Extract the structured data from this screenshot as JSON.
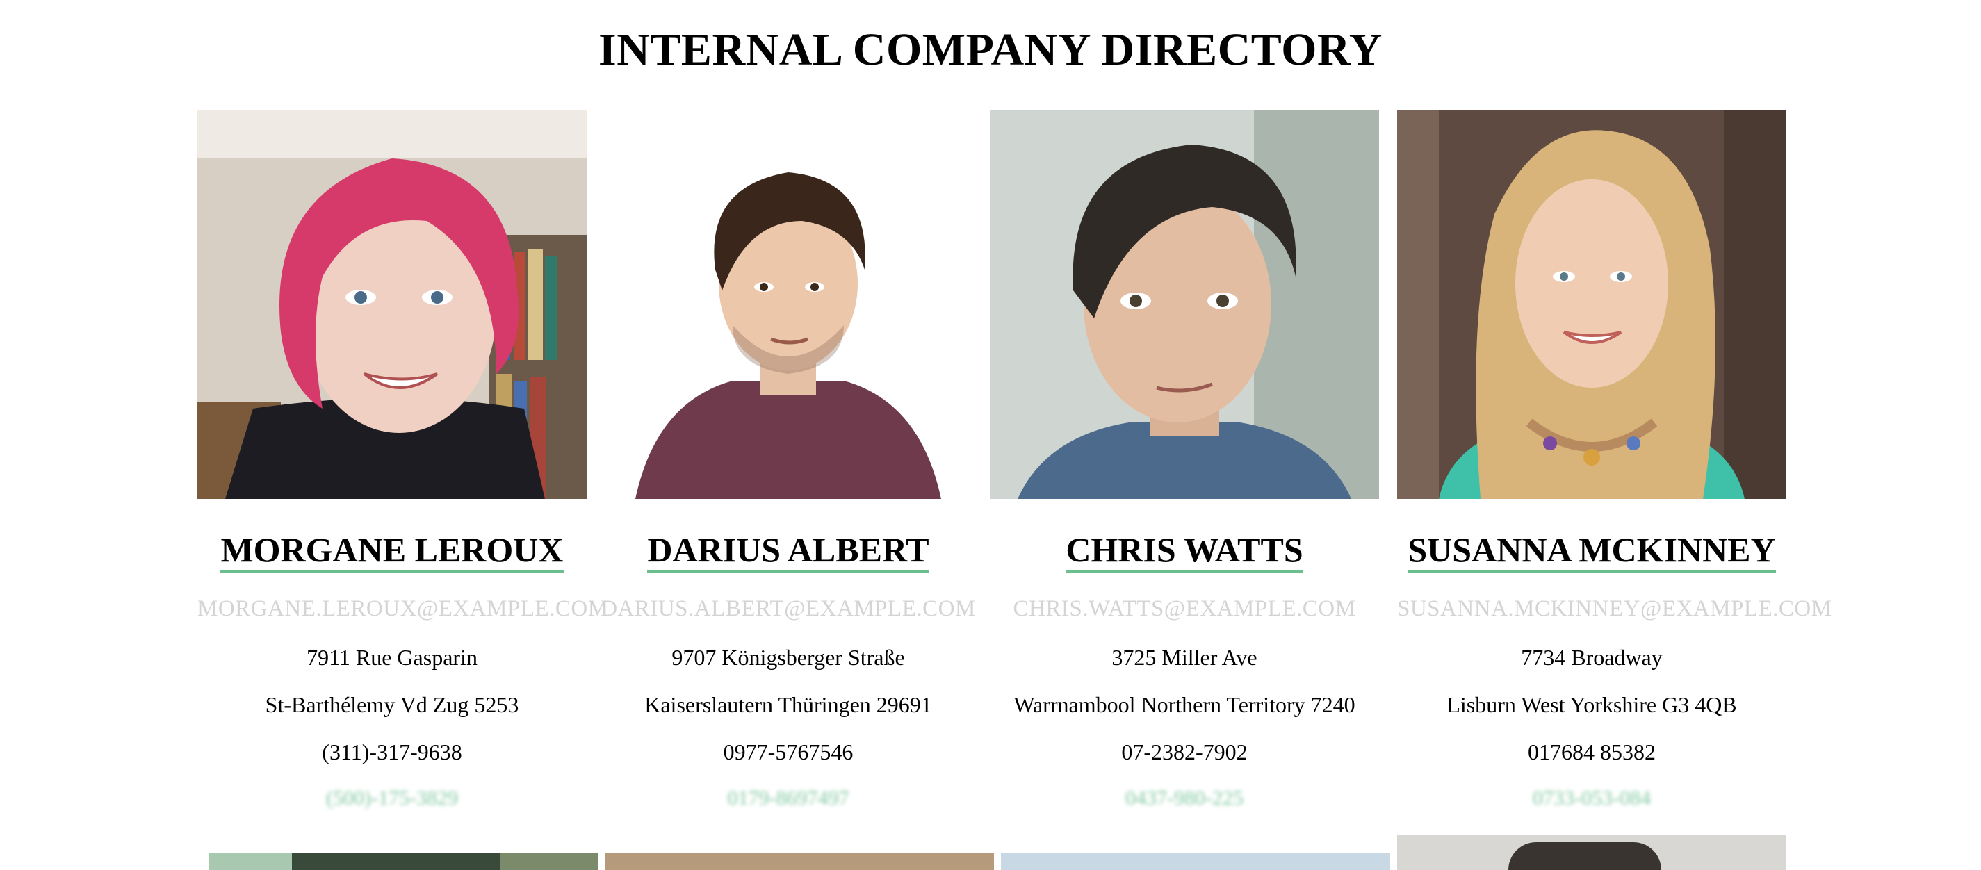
{
  "page": {
    "title": "INTERNAL COMPANY DIRECTORY"
  },
  "people": [
    {
      "name": "MORGANE LEROUX",
      "email": "MORGANE.LEROUX@EXAMPLE.COM",
      "street": "7911 Rue Gasparin",
      "city": "St-Barthélemy Vd Zug 5253",
      "phone": "(311)-317-9638",
      "cell": "(500)-175-3829"
    },
    {
      "name": "DARIUS ALBERT",
      "email": "DARIUS.ALBERT@EXAMPLE.COM",
      "street": "9707 Königsberger Straße",
      "city": "Kaiserslautern Thüringen 29691",
      "phone": "0977-5767546",
      "cell": "0179-8697497"
    },
    {
      "name": "CHRIS WATTS",
      "email": "CHRIS.WATTS@EXAMPLE.COM",
      "street": "3725 Miller Ave",
      "city": "Warrnambool Northern Territory 7240",
      "phone": "07-2382-7902",
      "cell": "0437-980-225"
    },
    {
      "name": "SUSANNA MCKINNEY",
      "email": "SUSANNA.MCKINNEY@EXAMPLE.COM",
      "street": "7734 Broadway",
      "city": "Lisburn West Yorkshire G3 4QB",
      "phone": "017684 85382",
      "cell": "0733-053-084"
    }
  ],
  "colors": {
    "link_underline": "#6cbf8c",
    "email": "#d4d4d4",
    "cell": "#82c8a2"
  }
}
